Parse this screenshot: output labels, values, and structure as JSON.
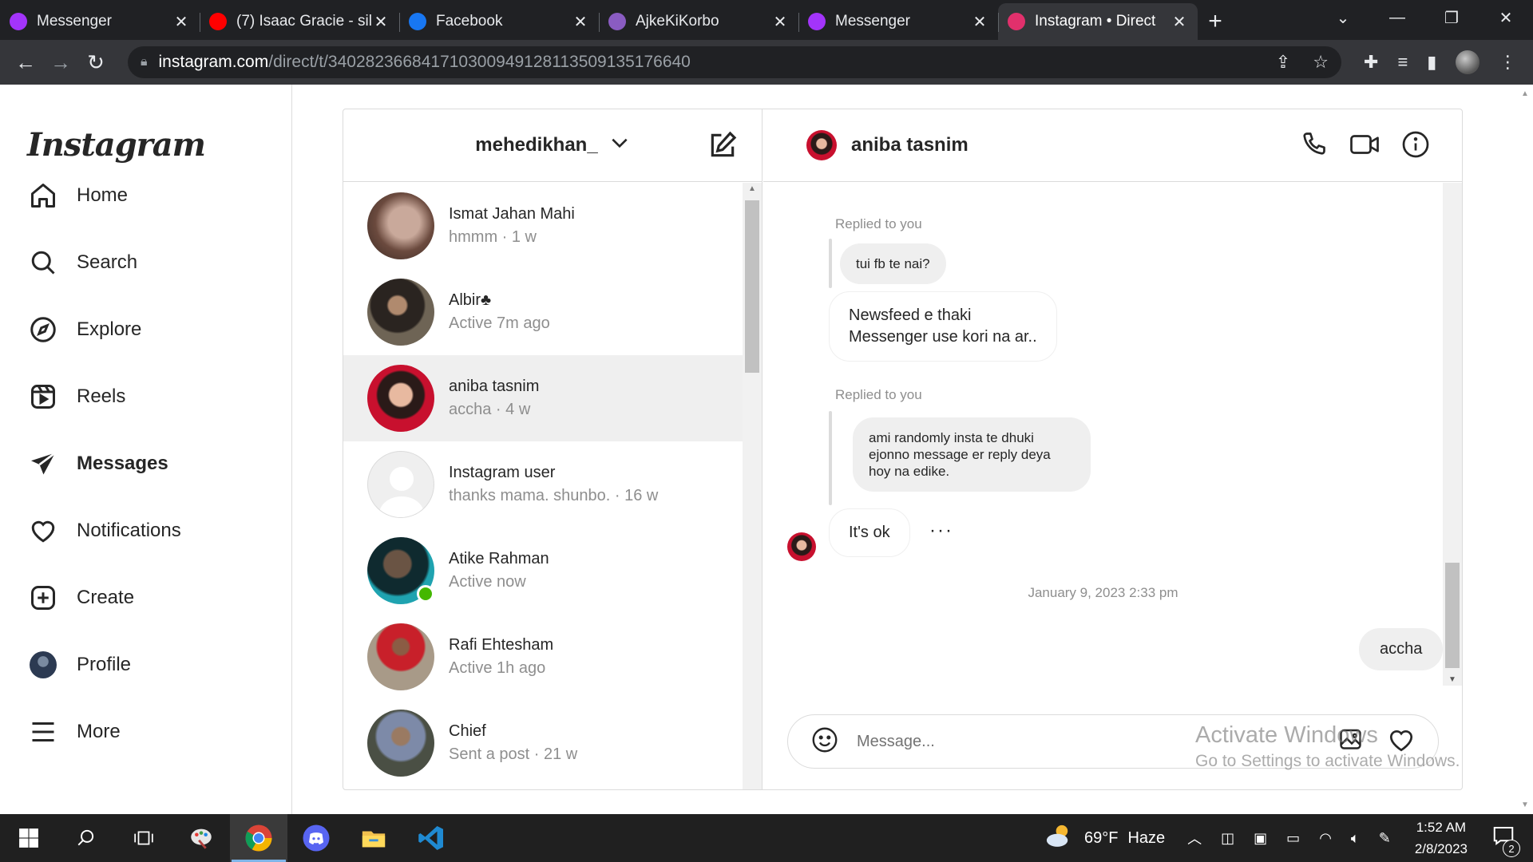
{
  "browser": {
    "tabs": [
      {
        "title": "Messenger",
        "icon": "messenger-icon",
        "color": "#a334fa"
      },
      {
        "title": "(7) Isaac Gracie - sil",
        "icon": "youtube-icon",
        "color": "#ff0000"
      },
      {
        "title": "Facebook",
        "icon": "facebook-icon",
        "color": "#1877f2"
      },
      {
        "title": "AjkeKiKorbo",
        "icon": "page-thumbnail-icon",
        "color": "#8a5cc2"
      },
      {
        "title": "Messenger",
        "icon": "messenger-icon",
        "color": "#a334fa"
      },
      {
        "title": "Instagram • Direct",
        "icon": "instagram-icon",
        "color": "#e1306c",
        "active": true
      }
    ],
    "url_host": "instagram.com",
    "url_path": "/direct/t/340282366841710300949128113509135176640"
  },
  "sidebar": {
    "logo": "Instagram",
    "items": [
      {
        "label": "Home",
        "icon": "home-icon"
      },
      {
        "label": "Search",
        "icon": "search-icon"
      },
      {
        "label": "Explore",
        "icon": "compass-icon"
      },
      {
        "label": "Reels",
        "icon": "reels-icon"
      },
      {
        "label": "Messages",
        "icon": "direct-icon",
        "active": true
      },
      {
        "label": "Notifications",
        "icon": "heart-icon"
      },
      {
        "label": "Create",
        "icon": "plus-square-icon"
      },
      {
        "label": "Profile",
        "icon": "profile-avatar"
      },
      {
        "label": "More",
        "icon": "menu-icon"
      }
    ]
  },
  "inbox": {
    "account": "mehedikhan_",
    "threads": [
      {
        "name": "Ismat Jahan Mahi",
        "subtitle": "hmmm · 1 w"
      },
      {
        "name": "Albir♣",
        "subtitle": "Active 7m ago"
      },
      {
        "name": "aniba tasnim",
        "subtitle": "accha · 4 w",
        "selected": true
      },
      {
        "name": "Instagram user",
        "subtitle": "thanks mama. shunbo. · 16 w"
      },
      {
        "name": "Atike Rahman",
        "subtitle": "Active now",
        "online": true
      },
      {
        "name": "Rafi Ehtesham",
        "subtitle": "Active 1h ago"
      },
      {
        "name": "Chief",
        "subtitle": "Sent a post · 21 w"
      }
    ]
  },
  "chat": {
    "peer_name": "aniba tasnim",
    "messages": {
      "replied_label_1": "Replied to you",
      "quoted_1": "tui fb te nai?",
      "reply_1_line1": "Newsfeed e thaki",
      "reply_1_line2": "Messenger use kori na ar..",
      "replied_label_2": "Replied to you",
      "quoted_2_line1": "ami randomly insta te dhuki",
      "quoted_2_line2": "ejonno message er reply deya",
      "quoted_2_line3": "hoy na edike.",
      "reply_2": "It's ok",
      "timestamp": "January 9, 2023 2:33 pm",
      "mine_1": "accha"
    },
    "composer_placeholder": "Message..."
  },
  "watermark": {
    "line1": "Activate Windows",
    "line2": "Go to Settings to activate Windows."
  },
  "taskbar": {
    "weather_temp": "69°F",
    "weather_desc": "Haze",
    "time": "1:52 AM",
    "date": "2/8/2023",
    "notification_count": "2"
  }
}
